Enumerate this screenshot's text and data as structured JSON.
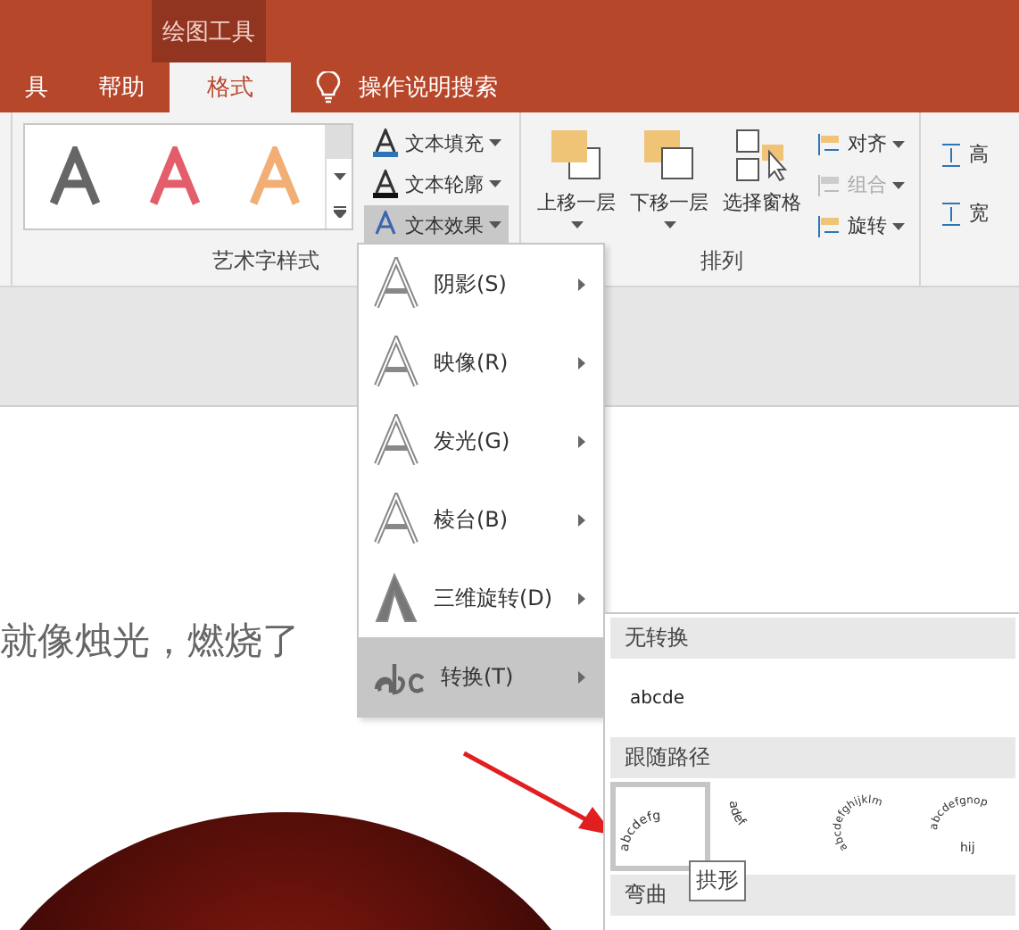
{
  "context_tab": {
    "label": "绘图工具"
  },
  "tabs": [
    {
      "label": "具",
      "selected": false
    },
    {
      "label": "帮助",
      "selected": false
    },
    {
      "label": "格式",
      "selected": true
    }
  ],
  "tell_me": {
    "label": "操作说明搜索"
  },
  "wordart_group": {
    "label": "艺术字样式",
    "commands": [
      {
        "label": "文本填充",
        "kind": "fill",
        "active": false
      },
      {
        "label": "文本轮廓",
        "kind": "outline",
        "active": false
      },
      {
        "label": "文本效果",
        "kind": "effect",
        "active": true
      }
    ]
  },
  "arrange_group": {
    "label": "排列",
    "large": [
      {
        "label": "上移一层",
        "kind": "forward"
      },
      {
        "label": "下移一层",
        "kind": "backward"
      },
      {
        "label": "选择窗格",
        "kind": "pane"
      }
    ],
    "small": [
      {
        "label": "对齐",
        "disabled": false
      },
      {
        "label": "组合",
        "disabled": true
      },
      {
        "label": "旋转",
        "disabled": false
      }
    ]
  },
  "size_group": {
    "items": [
      "高",
      "宽"
    ]
  },
  "slide": {
    "text": "就像烛光，燃烧了"
  },
  "effects_menu": [
    {
      "label": "阴影(S)",
      "kind": "shadow",
      "selected": false
    },
    {
      "label": "映像(R)",
      "kind": "reflection",
      "selected": false
    },
    {
      "label": "发光(G)",
      "kind": "glow",
      "selected": false
    },
    {
      "label": "棱台(B)",
      "kind": "bevel",
      "selected": false
    },
    {
      "label": "三维旋转(D)",
      "kind": "rotation",
      "selected": false
    },
    {
      "label": "转换(T)",
      "kind": "transform",
      "selected": true
    }
  ],
  "transform_menu": {
    "sections": [
      {
        "title": "无转换"
      },
      {
        "title": "跟随路径"
      },
      {
        "title": "弯曲"
      }
    ],
    "plain_sample": "abcde",
    "path_previews": [
      {
        "kind": "arch",
        "text": "abcdefg",
        "selected": true
      },
      {
        "kind": "arch-down",
        "text": "adef",
        "selected": false
      },
      {
        "kind": "circle",
        "text": "abcdefghijklm",
        "selected": false
      },
      {
        "kind": "button",
        "text": "abcdefgnop",
        "inner": "hij",
        "selected": false
      }
    ],
    "tooltip": "拱形"
  }
}
